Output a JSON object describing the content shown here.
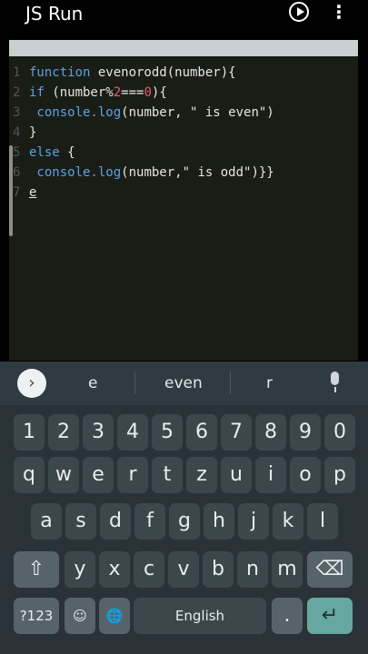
{
  "app": {
    "title": "JS Run",
    "play_glyph": "play-icon",
    "more_glyph": "⋮"
  },
  "editor": {
    "lines": [
      {
        "n": "1",
        "tokens": [
          {
            "t": "function ",
            "c": "kw"
          },
          {
            "t": "evenorodd(number){",
            "c": "fn"
          }
        ]
      },
      {
        "n": "2",
        "tokens": [
          {
            "t": "if",
            "c": "kw"
          },
          {
            "t": " (number%",
            "c": "fn"
          },
          {
            "t": "2",
            "c": "num"
          },
          {
            "t": "===",
            "c": "fn"
          },
          {
            "t": "0",
            "c": "num"
          },
          {
            "t": "){",
            "c": "fn"
          }
        ]
      },
      {
        "n": "3",
        "tokens": [
          {
            "t": " console.log",
            "c": "mem"
          },
          {
            "t": "(number, \" is even\")",
            "c": "str"
          }
        ]
      },
      {
        "n": "4",
        "tokens": [
          {
            "t": "}",
            "c": "fn"
          }
        ]
      },
      {
        "n": "5",
        "tokens": [
          {
            "t": "else",
            "c": "kw"
          },
          {
            "t": " {",
            "c": "fn"
          }
        ]
      },
      {
        "n": "6",
        "tokens": [
          {
            "t": " console.log",
            "c": "mem"
          },
          {
            "t": "(number,\" is odd\")}}",
            "c": "str"
          }
        ]
      },
      {
        "n": "7",
        "tokens": [
          {
            "t": "e",
            "c": "und"
          }
        ]
      }
    ]
  },
  "keyboard": {
    "suggestions": [
      "e",
      "even",
      "r"
    ],
    "suggestion_arrow": "›",
    "row_numbers": [
      "1",
      "2",
      "3",
      "4",
      "5",
      "6",
      "7",
      "8",
      "9",
      "0"
    ],
    "row_q": [
      "q",
      "w",
      "e",
      "r",
      "t",
      "z",
      "u",
      "i",
      "o",
      "p"
    ],
    "row_a": [
      "a",
      "s",
      "d",
      "f",
      "g",
      "h",
      "j",
      "k",
      "l"
    ],
    "row_y": [
      "y",
      "x",
      "c",
      "v",
      "b",
      "n",
      "m"
    ],
    "shift_glyph": "⇧",
    "backspace_glyph": "⌫",
    "symbols_label": "?123",
    "emoji_glyph": "☺",
    "comma": ",",
    "globe_glyph": "🌐",
    "space_label": "English",
    "period": ".",
    "enter_glyph": "↵"
  },
  "colors": {
    "editor_bg": "#1a1d16",
    "keyword": "#5aa2e6",
    "number": "#e06070",
    "keyboard_bg": "#2a3238",
    "enter": "#66a7a1"
  }
}
